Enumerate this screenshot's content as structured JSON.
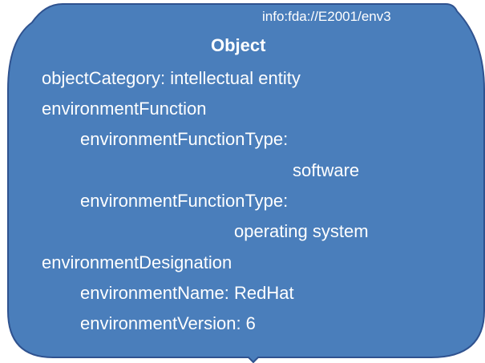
{
  "object": {
    "identifier": "info:fda://E2001/env3",
    "title": "Object",
    "fill_color": "#4a7ebb",
    "border_color": "#2f528f",
    "text_color": "#ffffff",
    "lines": [
      "objectCategory: intellectual entity",
      "environmentFunction",
      "environmentFunctionType:",
      "software",
      "environmentFunctionType:",
      "operating system",
      "environmentDesignation",
      "environmentName: RedHat",
      "environmentVersion: 6"
    ]
  }
}
